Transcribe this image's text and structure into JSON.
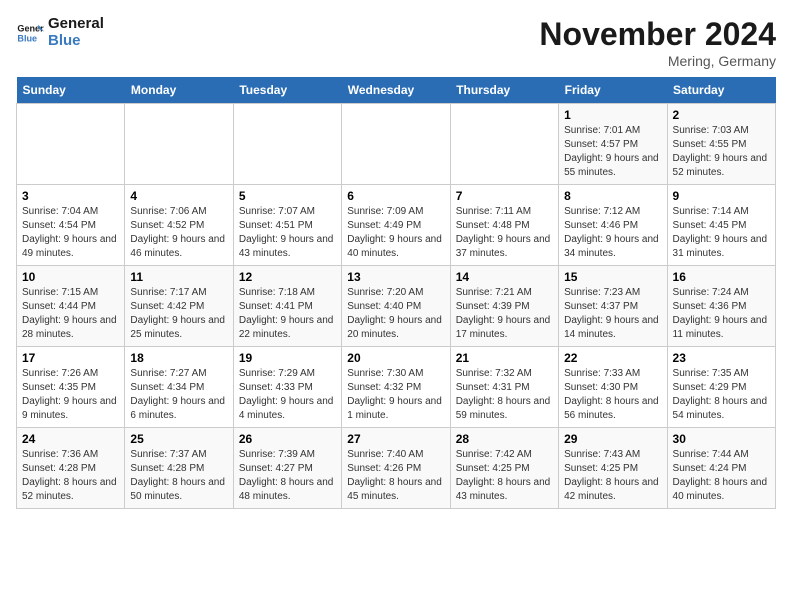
{
  "logo": {
    "general": "General",
    "blue": "Blue"
  },
  "header": {
    "month": "November 2024",
    "location": "Mering, Germany"
  },
  "days_of_week": [
    "Sunday",
    "Monday",
    "Tuesday",
    "Wednesday",
    "Thursday",
    "Friday",
    "Saturday"
  ],
  "weeks": [
    [
      {
        "day": "",
        "info": ""
      },
      {
        "day": "",
        "info": ""
      },
      {
        "day": "",
        "info": ""
      },
      {
        "day": "",
        "info": ""
      },
      {
        "day": "",
        "info": ""
      },
      {
        "day": "1",
        "info": "Sunrise: 7:01 AM\nSunset: 4:57 PM\nDaylight: 9 hours and 55 minutes."
      },
      {
        "day": "2",
        "info": "Sunrise: 7:03 AM\nSunset: 4:55 PM\nDaylight: 9 hours and 52 minutes."
      }
    ],
    [
      {
        "day": "3",
        "info": "Sunrise: 7:04 AM\nSunset: 4:54 PM\nDaylight: 9 hours and 49 minutes."
      },
      {
        "day": "4",
        "info": "Sunrise: 7:06 AM\nSunset: 4:52 PM\nDaylight: 9 hours and 46 minutes."
      },
      {
        "day": "5",
        "info": "Sunrise: 7:07 AM\nSunset: 4:51 PM\nDaylight: 9 hours and 43 minutes."
      },
      {
        "day": "6",
        "info": "Sunrise: 7:09 AM\nSunset: 4:49 PM\nDaylight: 9 hours and 40 minutes."
      },
      {
        "day": "7",
        "info": "Sunrise: 7:11 AM\nSunset: 4:48 PM\nDaylight: 9 hours and 37 minutes."
      },
      {
        "day": "8",
        "info": "Sunrise: 7:12 AM\nSunset: 4:46 PM\nDaylight: 9 hours and 34 minutes."
      },
      {
        "day": "9",
        "info": "Sunrise: 7:14 AM\nSunset: 4:45 PM\nDaylight: 9 hours and 31 minutes."
      }
    ],
    [
      {
        "day": "10",
        "info": "Sunrise: 7:15 AM\nSunset: 4:44 PM\nDaylight: 9 hours and 28 minutes."
      },
      {
        "day": "11",
        "info": "Sunrise: 7:17 AM\nSunset: 4:42 PM\nDaylight: 9 hours and 25 minutes."
      },
      {
        "day": "12",
        "info": "Sunrise: 7:18 AM\nSunset: 4:41 PM\nDaylight: 9 hours and 22 minutes."
      },
      {
        "day": "13",
        "info": "Sunrise: 7:20 AM\nSunset: 4:40 PM\nDaylight: 9 hours and 20 minutes."
      },
      {
        "day": "14",
        "info": "Sunrise: 7:21 AM\nSunset: 4:39 PM\nDaylight: 9 hours and 17 minutes."
      },
      {
        "day": "15",
        "info": "Sunrise: 7:23 AM\nSunset: 4:37 PM\nDaylight: 9 hours and 14 minutes."
      },
      {
        "day": "16",
        "info": "Sunrise: 7:24 AM\nSunset: 4:36 PM\nDaylight: 9 hours and 11 minutes."
      }
    ],
    [
      {
        "day": "17",
        "info": "Sunrise: 7:26 AM\nSunset: 4:35 PM\nDaylight: 9 hours and 9 minutes."
      },
      {
        "day": "18",
        "info": "Sunrise: 7:27 AM\nSunset: 4:34 PM\nDaylight: 9 hours and 6 minutes."
      },
      {
        "day": "19",
        "info": "Sunrise: 7:29 AM\nSunset: 4:33 PM\nDaylight: 9 hours and 4 minutes."
      },
      {
        "day": "20",
        "info": "Sunrise: 7:30 AM\nSunset: 4:32 PM\nDaylight: 9 hours and 1 minute."
      },
      {
        "day": "21",
        "info": "Sunrise: 7:32 AM\nSunset: 4:31 PM\nDaylight: 8 hours and 59 minutes."
      },
      {
        "day": "22",
        "info": "Sunrise: 7:33 AM\nSunset: 4:30 PM\nDaylight: 8 hours and 56 minutes."
      },
      {
        "day": "23",
        "info": "Sunrise: 7:35 AM\nSunset: 4:29 PM\nDaylight: 8 hours and 54 minutes."
      }
    ],
    [
      {
        "day": "24",
        "info": "Sunrise: 7:36 AM\nSunset: 4:28 PM\nDaylight: 8 hours and 52 minutes."
      },
      {
        "day": "25",
        "info": "Sunrise: 7:37 AM\nSunset: 4:28 PM\nDaylight: 8 hours and 50 minutes."
      },
      {
        "day": "26",
        "info": "Sunrise: 7:39 AM\nSunset: 4:27 PM\nDaylight: 8 hours and 48 minutes."
      },
      {
        "day": "27",
        "info": "Sunrise: 7:40 AM\nSunset: 4:26 PM\nDaylight: 8 hours and 45 minutes."
      },
      {
        "day": "28",
        "info": "Sunrise: 7:42 AM\nSunset: 4:25 PM\nDaylight: 8 hours and 43 minutes."
      },
      {
        "day": "29",
        "info": "Sunrise: 7:43 AM\nSunset: 4:25 PM\nDaylight: 8 hours and 42 minutes."
      },
      {
        "day": "30",
        "info": "Sunrise: 7:44 AM\nSunset: 4:24 PM\nDaylight: 8 hours and 40 minutes."
      }
    ]
  ]
}
